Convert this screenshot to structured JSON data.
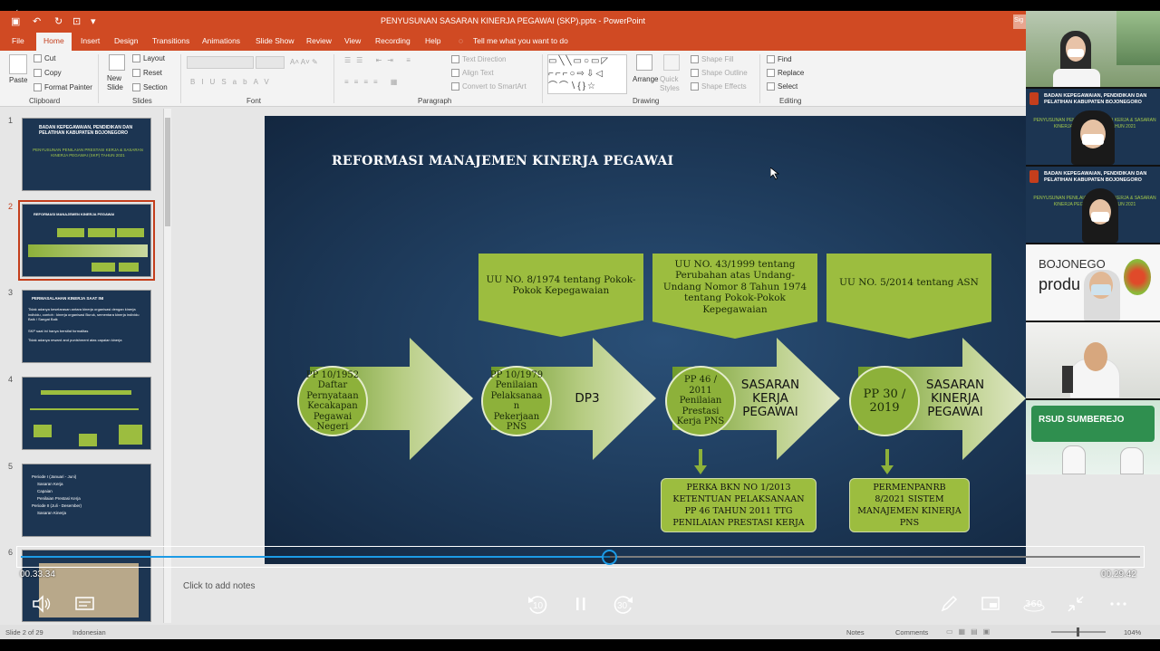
{
  "window": {
    "title": "PENYUSUNAN SASARAN KINERJA PEGAWAI (SKP).pptx  -  PowerPoint",
    "signin": "Sig"
  },
  "tabs": [
    "File",
    "Home",
    "Insert",
    "Design",
    "Transitions",
    "Animations",
    "Slide Show",
    "Review",
    "View",
    "Recording",
    "Help"
  ],
  "tell_me": "Tell me what you want to do",
  "ribbon": {
    "paste": "Paste",
    "cut": "Cut",
    "copy": "Copy",
    "format_painter": "Format Painter",
    "new_slide": "New Slide",
    "layout": "Layout",
    "reset": "Reset",
    "section": "Section",
    "text_direction": "Text Direction",
    "align_text": "Align Text",
    "convert_smartart": "Convert to SmartArt",
    "arrange": "Arrange",
    "quick_styles": "Quick Styles",
    "shape_fill": "Shape Fill",
    "shape_outline": "Shape Outline",
    "shape_effects": "Shape Effects",
    "find": "Find",
    "replace": "Replace",
    "select": "Select",
    "groups": [
      "Clipboard",
      "Slides",
      "Font",
      "Paragraph",
      "Drawing",
      "Editing"
    ]
  },
  "thumbnails": [
    {
      "num": "1",
      "title": "BADAN KEPEGAWAIAN, PENDIDIKAN DAN PELATIHAN KABUPATEN BOJONEGORO",
      "subtitle": "PENYUSUNAN PENILAIAN PRESTASI KERJA & SASARAN KINERJA PEGAWAI (SKP) TAHUN 2021"
    },
    {
      "num": "2",
      "title": "REFORMASI MANAJEMEN KINERJA PEGAWAI"
    },
    {
      "num": "3",
      "title": "PERMASALAHAN KINERJA SAAT INI",
      "lines": [
        "Tidak adanya keselarasan antara kinerja organisasi dengan kinerja individu, contoh : kinerja organisasi Buruk, sementara kinerja individu Baik / Sangat Baik",
        "SKP saat ini hanya bersifat formalitas",
        "Tidak adanya reward and punishment atas capaian kinerja"
      ]
    },
    {
      "num": "4",
      "title": ""
    },
    {
      "num": "5",
      "lines": [
        "Periode I (Januari - Juni)",
        "Sasaran Kerja",
        "Capaian",
        "Penilaian Prestasi Kerja",
        "Periode II (Juli - Desember)",
        "Sasaran Kinerja"
      ]
    },
    {
      "num": "6",
      "title": ""
    }
  ],
  "slide": {
    "title": "REFORMASI MANAJEMEN KINERJA PEGAWAI",
    "banners": [
      "UU NO. 8/1974 tentang Pokok-Pokok Kepegawaian",
      "UU NO. 43/1999 tentang Perubahan atas Undang-Undang Nomor 8 Tahun 1974 tentang Pokok-Pokok Kepegawaian",
      "UU NO. 5/2014 tentang ASN"
    ],
    "circles": [
      "PP 10/1952 Daftar Pernyataan Kecakapan Pegawai Negeri",
      "PP 10/1979 Penilaian Pelaksanaa n Pekerjaan PNS",
      "PP 46 / 2011 Penilaian Prestasi Kerja PNS",
      "PP 30 / 2019"
    ],
    "arrow_labels": [
      "DP3",
      "SASARAN KERJA PEGAWAI",
      "SASARAN KINERJA PEGAWAI"
    ],
    "boxes": [
      "PERKA BKN NO 1/2013 KETENTUAN PELAKSANAAN PP 46 TAHUN 2011 TTG PENILAIAN PRESTASI KERJA",
      "PERMENPANRB 8/2021 SISTEM MANAJEMEN KINERJA PNS"
    ]
  },
  "notes_placeholder": "Click to add notes",
  "status": {
    "slide": "Slide 2 of 29",
    "language": "Indonesian",
    "notes": "Notes",
    "comments": "Comments",
    "zoom": "104%"
  },
  "player": {
    "elapsed": "00.33.34",
    "remaining": "00.29.42",
    "progress": 0.526,
    "skip_back": "10",
    "skip_fwd": "30"
  },
  "video_tiles": [
    {
      "label": ""
    },
    {
      "banner": "BADAN KEPEGAWAIAN, PENDIDIKAN DAN PELATIHAN KABUPATEN BOJONEGORO",
      "sub": "PENYUSUNAN PENILAIAN PRESTASI KERJA & SASARAN KINERJA PEGAWAI (SKP) TAHUN 2021"
    },
    {
      "banner": "BADAN KEPEGAWAIAN, PENDIDIKAN DAN PELATIHAN KABUPATEN BOJONEGORO",
      "sub": "PENYUSUNAN PENILAIAN PRESTASI KERJA & SASARAN KINERJA PEGAWAI (SKP) TAHUN 2021"
    },
    {
      "brand": "BOJONEGO",
      "brand2": "produ"
    },
    {
      "label": ""
    },
    {
      "label": "RSUD SUMBEREJO"
    }
  ],
  "colors": {
    "accent": "#d04a23",
    "slide_bg": "#1d3a5a",
    "green": "#9cbd3f",
    "progress": "#1c9be6"
  }
}
